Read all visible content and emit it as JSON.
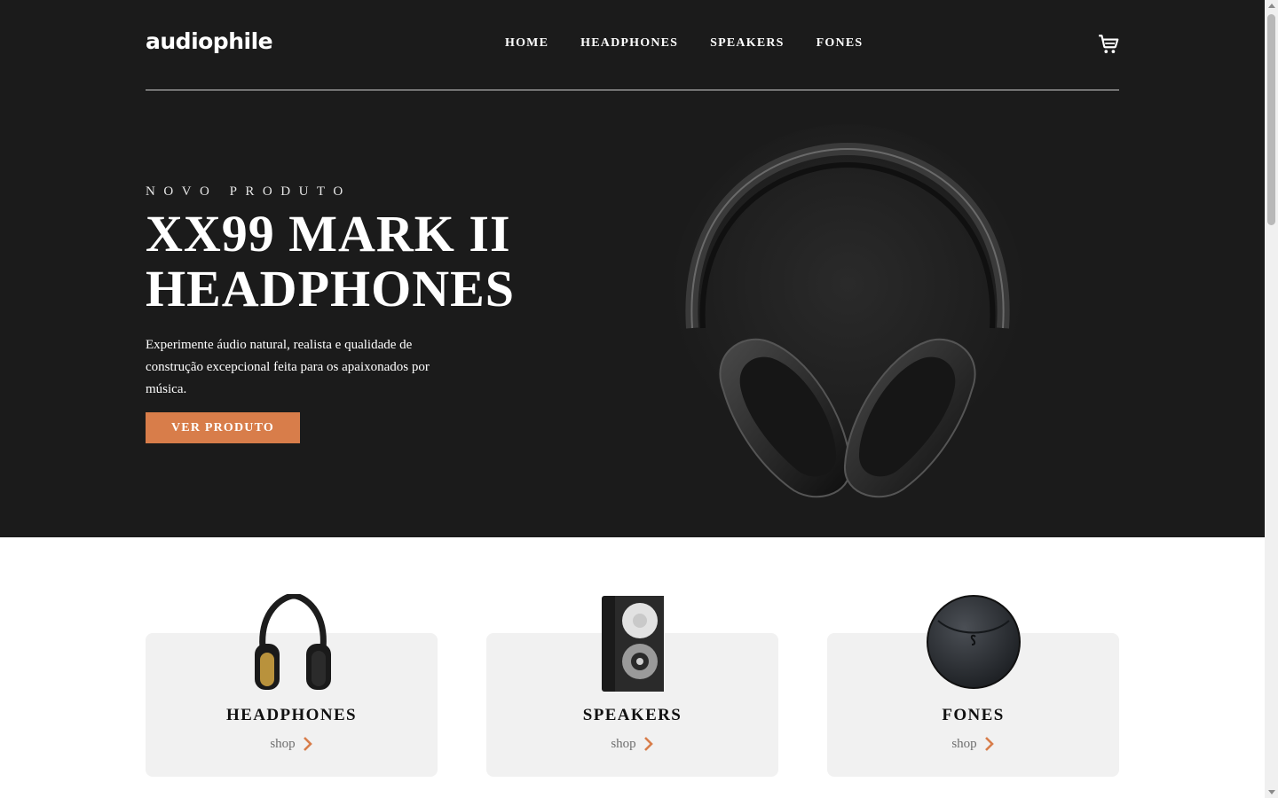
{
  "header": {
    "logo": "audiophile",
    "nav": [
      "HOME",
      "HEADPHONES",
      "SPEAKERS",
      "FONES"
    ],
    "cart_icon": "cart-icon"
  },
  "hero": {
    "overline": "NOVO PRODUTO",
    "title_line1": "XX99 MARK II",
    "title_line2": "HEADPHONES",
    "description": "Experimente áudio natural, realista e qualidade de construção excepcional feita para os apaixonados por música.",
    "cta_label": "VER PRODUTO"
  },
  "categories": [
    {
      "name": "HEADPHONES",
      "link": "shop",
      "icon": "headphones-image"
    },
    {
      "name": "SPEAKERS",
      "link": "shop",
      "icon": "speaker-image"
    },
    {
      "name": "FONES",
      "link": "shop",
      "icon": "earphones-case-image"
    }
  ],
  "colors": {
    "hero_bg": "#1b1b1b",
    "accent": "#d87d4a",
    "card_bg": "#f1f1f1"
  }
}
